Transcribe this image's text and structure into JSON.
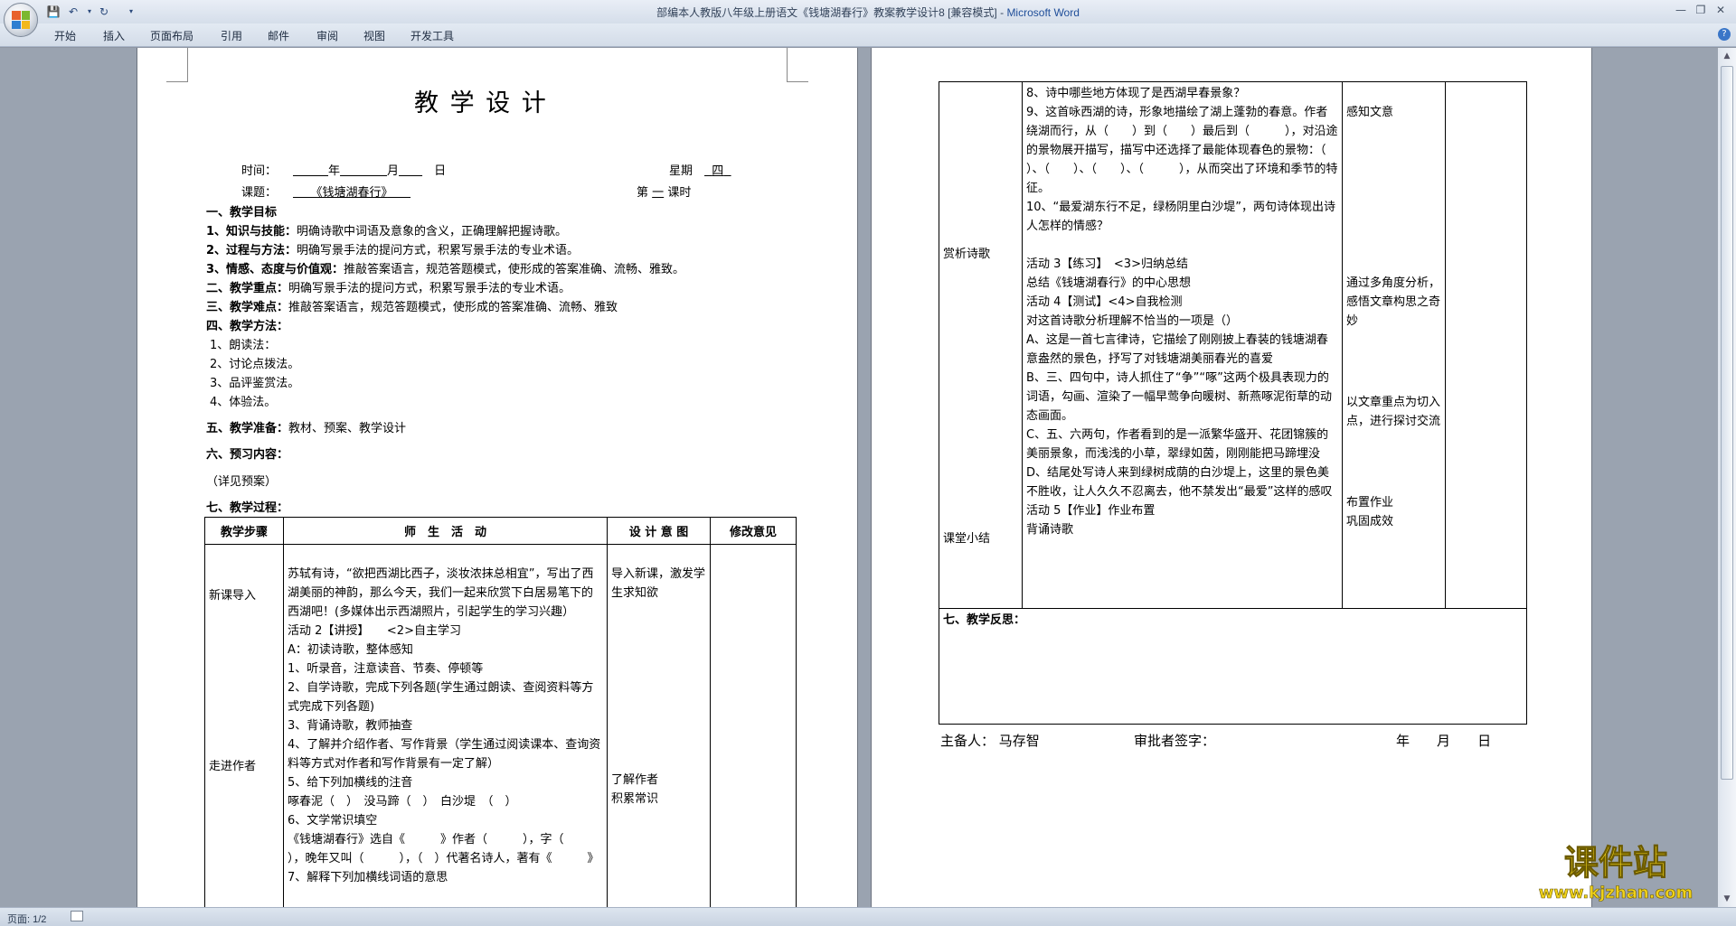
{
  "window": {
    "title_doc": "部编本人教版八年级上册语文《钱塘湖春行》教案教学设计8 [兼容模式]",
    "title_sep": " - ",
    "title_app": "Microsoft Word"
  },
  "ribbon": {
    "tabs": [
      "开始",
      "插入",
      "页面布局",
      "引用",
      "邮件",
      "审阅",
      "视图",
      "开发工具"
    ]
  },
  "status": {
    "page": "页面: 1/2"
  },
  "watermark": {
    "line1": "课件站",
    "line2": "www.kjzhan.com"
  },
  "page1": {
    "title": "教 学 设 计",
    "time_label": "时间：",
    "year": "年",
    "month": "月",
    "day": "日",
    "weekday_label": "星期",
    "weekday_value": "四",
    "topic_label": "课题：",
    "topic_value": "《钱塘湖春行》",
    "lesson_pre": "第",
    "lesson_num": "一",
    "lesson_post": "课时",
    "h1": "一、教学目标",
    "goal1_label": "1、知识与技能：",
    "goal1_text": "明确诗歌中词语及意象的含义，正确理解把握诗歌。",
    "goal2_label": "2、过程与方法：",
    "goal2_text": "明确写景手法的提问方式，积累写景手法的专业术语。",
    "goal3_label": "3、情感、态度与价值观：",
    "goal3_text": "推敲答案语言，规范答题模式，使形成的答案准确、流畅、雅致。",
    "h2": "二、教学重点：",
    "h2_text": "明确写景手法的提问方式，积累写景手法的专业术语。",
    "h3": "三、教学难点：",
    "h3_text": "推敲答案语言，规范答题模式，使形成的答案准确、流畅、雅致",
    "h4": "四、教学方法：",
    "methods": [
      "1、朗读法：",
      "2、讨论点拨法。",
      "3、品评鉴赏法。",
      "4、体验法。"
    ],
    "h5": "五、教学准备：",
    "h5_text": "教材、预案、教学设计",
    "h6": "六、预习内容：",
    "h6_text": "（详见预案）",
    "h7": "七、教学过程：",
    "table_headers": [
      "教学步骤",
      "师　生　活　动",
      "设 计 意 图",
      "修改意见"
    ],
    "step1": "新课导入",
    "step2": "走进作者",
    "activity": "苏轼有诗，“欲把西湖比西子，淡妆浓抹总相宜”，写出了西湖美丽的神韵，那么今天，我们一起来欣赏下白居易笔下的西湖吧！(多媒体出示西湖照片，引起学生的学习兴趣）\n活动 2【讲授】　　<2>自主学习\nA：初读诗歌，整体感知\n1、听录音，注意读音、节奏、停顿等\n2、自学诗歌，完成下列各题(学生通过朗读、查阅资料等方式完成下列各题)\n3、背诵诗歌，教师抽查\n4、了解并介绍作者、写作背景（学生通过阅读课本、查询资料等方式对作者和写作背景有一定了解）\n5、给下列加横线的注音\n啄春泥（　）　没马蹄（　）　白沙堤　（　）\n6、文学常识填空\n《钱塘湖春行》选自《　　　》作者（　　　），字（　　），晚年又叫（　　　），（　）代著名诗人，著有《　　　》\n7、解释下列加横线词语的意思",
    "intent1": "导入新课，激发学生求知欲",
    "intent2": "了解作者\n积累常识"
  },
  "page2": {
    "step3": "赏析诗歌",
    "step4": "课堂小结",
    "activity": "8、诗中哪些地方体现了是西湖早春景象？\n9、这首咏西湖的诗，形象地描绘了湖上蓬勃的春意。作者绕湖而行，从（　　）到（　　）最后到（　　　），对沿途的景物展开描写，描写中还选择了最能体现春色的景物：（　　）、（　　）、（　　）、（　　　），从而突出了环境和季节的特征。\n10、“最爱湖东行不足，绿杨阴里白沙堤”，两句诗体现出诗人怎样的情感？\n\n活动 3【练习】　<3>归纳总结\n总结《钱塘湖春行》的中心思想\n活动 4【测试】<4>自我检测\n对这首诗歌分析理解不恰当的一项是（）\nA、这是一首七言律诗，它描绘了刚刚披上春装的钱塘湖春意盎然的景色，抒写了对钱塘湖美丽春光的喜爱\nB、三、四句中，诗人抓住了“争”“啄”这两个极具表现力的词语，勾画、渲染了一幅早莺争向暖树、新燕啄泥衔草的动态画面。\nC、五、六两句，作者看到的是一派繁华盛开、花团锦簇的美丽景象，而浅浅的小草，翠绿如茵，刚刚能把马蹄埋没\nD、结尾处写诗人来到绿树成荫的白沙堤上，这里的景色美不胜收，让人久久不忍离去，他不禁发出“最爱”这样的感叹\n活动 5【作业】作业布置\n背诵诗歌",
    "intent1": "感知文意",
    "intent2": "通过多角度分析，感悟文章构思之奇妙",
    "intent3": "以文章重点为切入点，进行探讨交流",
    "intent4": "布置作业\n巩固成效",
    "reflection": "七、教学反思：",
    "preparer_label": "主备人：",
    "preparer": "马存智",
    "approver_label": "审批者签字：",
    "year": "年",
    "month": "月",
    "day": "日"
  }
}
